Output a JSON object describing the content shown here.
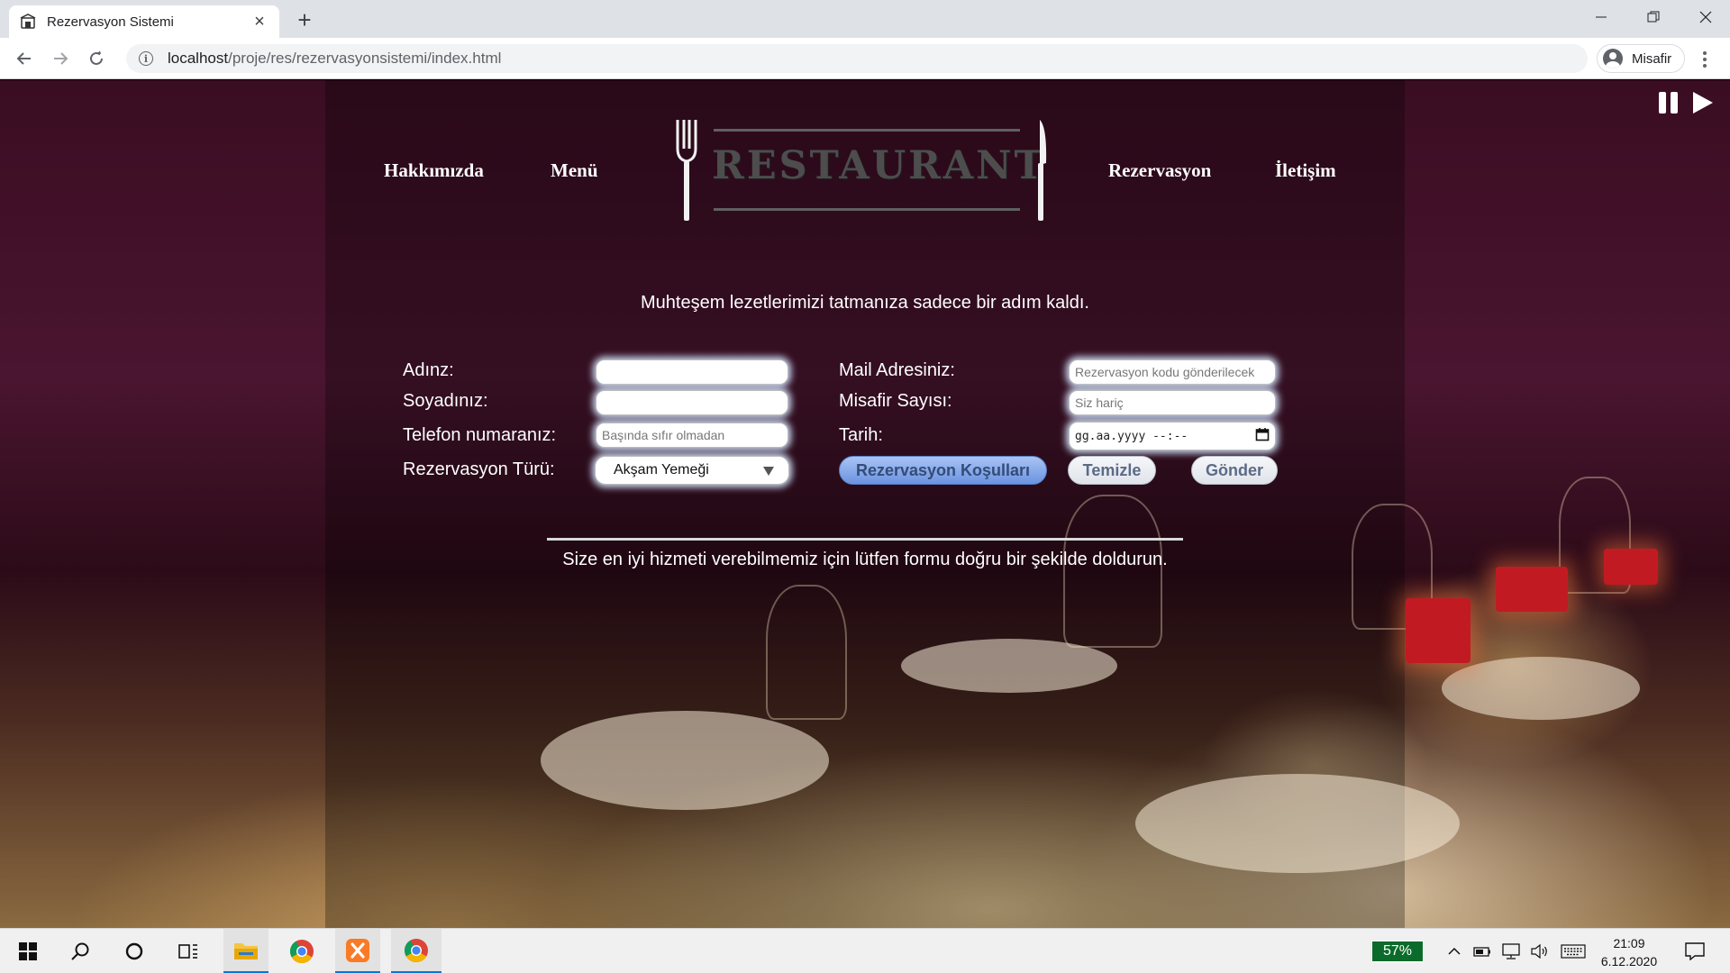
{
  "browser": {
    "tab_title": "Rezervasyon Sistemi",
    "url_host": "localhost",
    "url_path": "/proje/res/rezervasyonsistemi/index.html",
    "profile_name": "Misafir"
  },
  "nav": {
    "about": "Hakkımızda",
    "menu": "Menü",
    "reservation": "Rezervasyon",
    "contact": "İletişim"
  },
  "logo_text": "RESTAURANT",
  "intro_text": "Muhteşem lezetlerimizi tatmanıza sadece bir adım kaldı.",
  "form": {
    "name_label": "Adınz:",
    "surname_label": "Soyadınız:",
    "phone_label": "Telefon numaranız:",
    "phone_placeholder": "Başında sıfır olmadan",
    "type_label": "Rezervasyon Türü:",
    "type_value": "Akşam Yemeği",
    "mail_label": "Mail Adresiniz:",
    "mail_placeholder": "Rezervasyon kodu gönderilecek",
    "guests_label": "Misafir Sayısı:",
    "guests_placeholder": "Siz hariç",
    "date_label": "Tarih:",
    "date_placeholder": "gg.aa.yyyy --:--",
    "terms_button": "Rezervasyon Koşulları",
    "clear_button": "Temizle",
    "submit_button": "Gönder"
  },
  "footer_note": "Size en iyi hizmeti verebilmemiz için lütfen formu doğru bir şekilde doldurun.",
  "taskbar": {
    "battery": "57%",
    "time": "21:09",
    "date": "6.12.2020"
  },
  "colors": {
    "accent": "#0078d7",
    "primary_button": "#6b93e0",
    "battery_bg": "#0b6b2a"
  }
}
